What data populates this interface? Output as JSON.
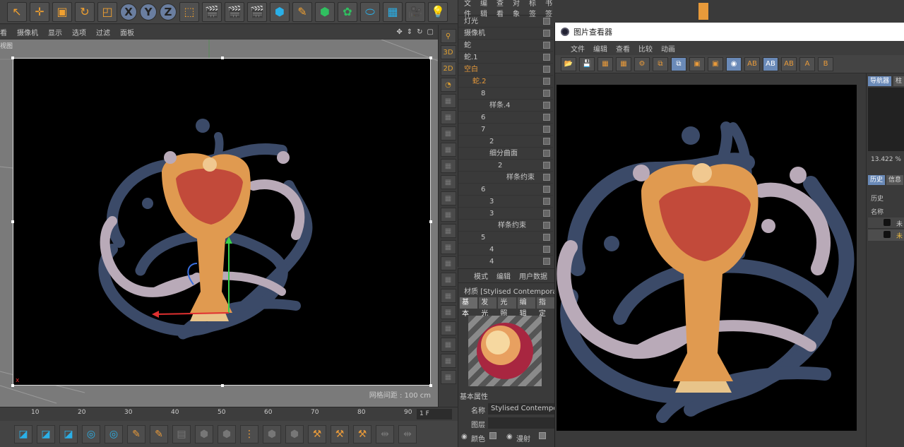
{
  "viewport": {
    "menu": [
      "看",
      "摄像机",
      "显示",
      "选项",
      "过滤",
      "面板"
    ],
    "label": "视图",
    "grid_spacing": "网格间距 : 100 cm",
    "axis_label": "x"
  },
  "timeline": {
    "ticks": [
      "10",
      "20",
      "30",
      "40",
      "50",
      "60",
      "70",
      "80",
      "90"
    ],
    "frame": "1 F"
  },
  "object_manager": {
    "menu": [
      "文件",
      "编辑",
      "查看",
      "对象",
      "标签",
      "书签"
    ],
    "rows": [
      {
        "label": "灯光",
        "indent": 0,
        "orange": false
      },
      {
        "label": "摄像机",
        "indent": 0,
        "orange": false
      },
      {
        "label": "蛇",
        "indent": 0,
        "orange": false
      },
      {
        "label": "蛇.1",
        "indent": 0,
        "orange": false
      },
      {
        "label": "空白",
        "indent": 0,
        "orange": true
      },
      {
        "label": "蛇.2",
        "indent": 1,
        "orange": true
      },
      {
        "label": "8",
        "indent": 2,
        "orange": false
      },
      {
        "label": "样条.4",
        "indent": 3,
        "orange": false
      },
      {
        "label": "6",
        "indent": 2,
        "orange": false
      },
      {
        "label": "7",
        "indent": 2,
        "orange": false
      },
      {
        "label": "2",
        "indent": 3,
        "orange": false
      },
      {
        "label": "细分曲面",
        "indent": 3,
        "orange": false
      },
      {
        "label": "2",
        "indent": 4,
        "orange": false
      },
      {
        "label": "样条约束",
        "indent": 5,
        "orange": false
      },
      {
        "label": "6",
        "indent": 2,
        "orange": false
      },
      {
        "label": "3",
        "indent": 3,
        "orange": false
      },
      {
        "label": "3",
        "indent": 3,
        "orange": false
      },
      {
        "label": "样条约束",
        "indent": 4,
        "orange": false
      },
      {
        "label": "5",
        "indent": 2,
        "orange": false
      },
      {
        "label": "4",
        "indent": 3,
        "orange": false
      },
      {
        "label": "4",
        "indent": 3,
        "orange": false
      }
    ]
  },
  "attribute_manager": {
    "menu": [
      "模式",
      "编辑",
      "用户数据"
    ],
    "material_title": "材质 [Stylised Contempora",
    "tabs": [
      "基本",
      "发光",
      "光照",
      "编辑",
      "指定"
    ],
    "section": "基本属性",
    "name_label": "名称",
    "name_value": "Stylised Contempora",
    "layer_label": "图层",
    "color_label": "颜色",
    "diffuse_label": "漫射"
  },
  "picture_viewer": {
    "title": "图片查看器",
    "menu": [
      "文件",
      "编辑",
      "查看",
      "比较",
      "动画"
    ],
    "tabs_top": [
      "导航器",
      "柱"
    ],
    "zoom": "13.422 %",
    "tabs_mid": [
      "历史",
      "信息"
    ],
    "history_label": "历史",
    "name_label": "名称",
    "entries": [
      "未",
      "未"
    ]
  },
  "colors": {
    "accent": "#e89a3a",
    "selected_blue": "#6a8ab8",
    "render_bg": "#000000"
  }
}
